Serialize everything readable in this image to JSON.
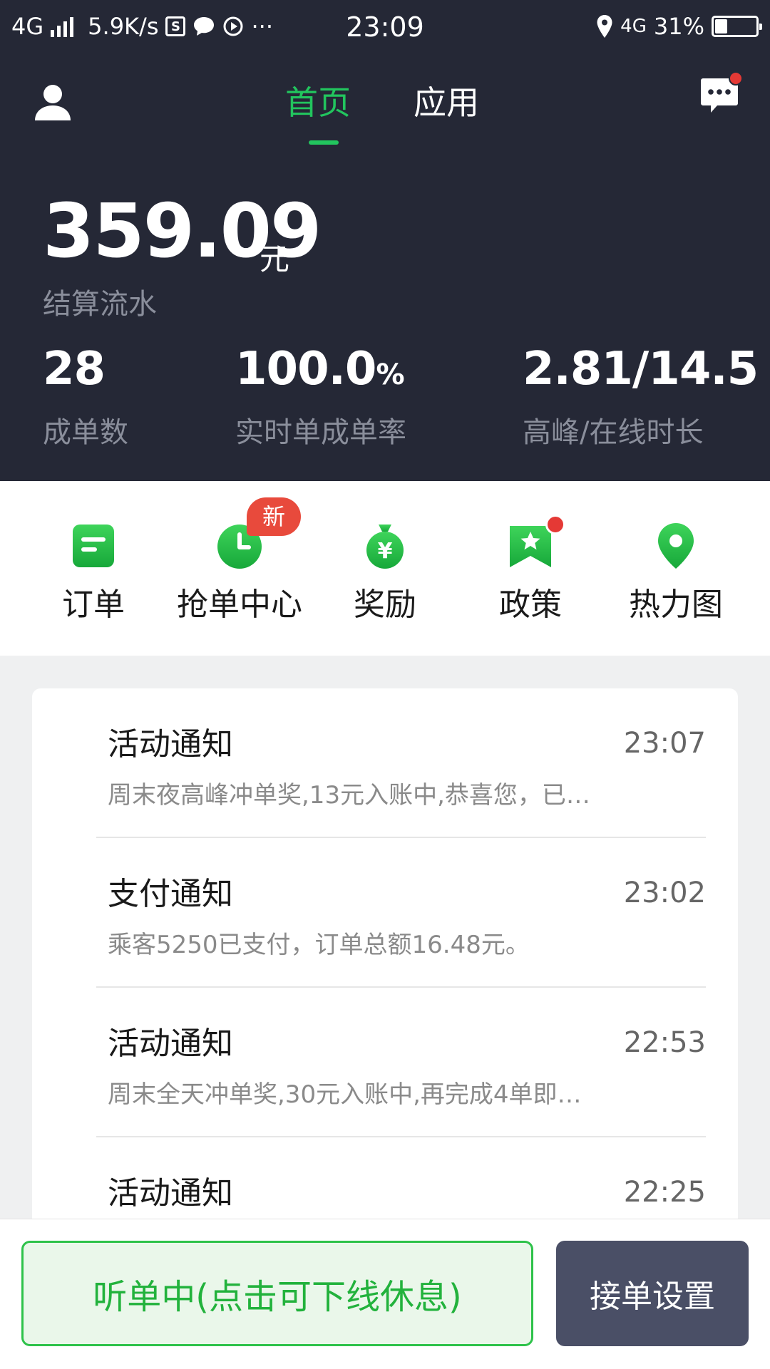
{
  "status_bar": {
    "network": "4G",
    "speed": "5.9K/s",
    "s_icon_letter": "S",
    "dots": "···",
    "time": "23:09",
    "network_right": "4G",
    "battery": "31%",
    "battery_level": 0.31
  },
  "header": {
    "tabs": [
      {
        "label": "首页",
        "active": true
      },
      {
        "label": "应用",
        "active": false
      }
    ],
    "accent_color": "#22c55e"
  },
  "summary": {
    "amount": "359.09",
    "unit": "元",
    "label": "结算流水"
  },
  "stats": [
    {
      "value": "28",
      "suffix": "",
      "label": "成单数"
    },
    {
      "value": "100.0",
      "suffix": "%",
      "label": "实时单成单率"
    },
    {
      "value": "2.81/14.5",
      "suffix": "",
      "label": "高峰/在线时长"
    }
  ],
  "quick_actions": [
    {
      "label": "订单",
      "icon": "order-icon"
    },
    {
      "label": "抢单中心",
      "icon": "clock-icon",
      "badge": "新"
    },
    {
      "label": "奖励",
      "icon": "money-bag-icon"
    },
    {
      "label": "政策",
      "icon": "policy-flag-icon"
    },
    {
      "label": "热力图",
      "icon": "location-pin-icon"
    }
  ],
  "notices": [
    {
      "title": "活动通知",
      "time": "23:07",
      "desc": "周末夜高峰冲单奖,13元入账中,恭喜您，已…"
    },
    {
      "title": "支付通知",
      "time": "23:02",
      "desc": "乘客5250已支付，订单总额16.48元。"
    },
    {
      "title": "活动通知",
      "time": "22:53",
      "desc": "周末全天冲单奖,30元入账中,再完成4单即…"
    },
    {
      "title": "活动通知",
      "time": "22:25",
      "desc": ""
    }
  ],
  "bottom": {
    "listen_label": "听单中(点击可下线休息)",
    "settings_label": "接单设置"
  }
}
